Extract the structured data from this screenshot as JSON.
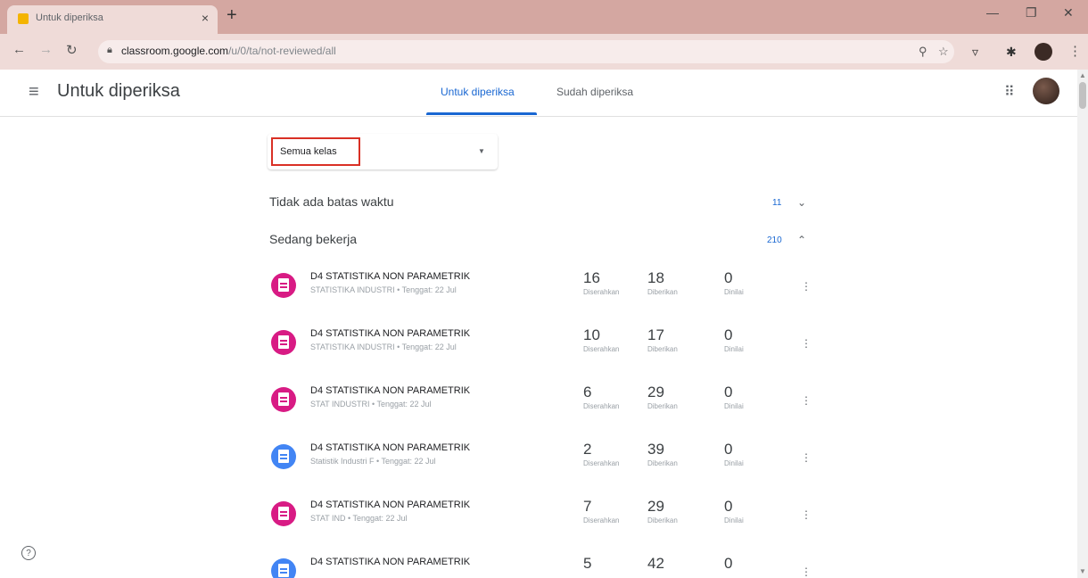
{
  "browser": {
    "tab_title": "Untuk diperiksa",
    "close_glyph": "×",
    "newtab_glyph": "+",
    "url_host": "classroom.google.com",
    "url_path": "/u/0/ta/not-reviewed/all"
  },
  "header": {
    "title": "Untuk diperiksa",
    "tabs": [
      "Untuk diperiksa",
      "Sudah diperiksa"
    ]
  },
  "filter": {
    "label": "Semua kelas"
  },
  "sections": [
    {
      "title": "Tidak ada batas waktu",
      "count": "11",
      "expanded": false
    },
    {
      "title": "Sedang bekerja",
      "count": "210",
      "expanded": true
    }
  ],
  "assignments": [
    {
      "title": "D4 STATISTIKA NON PARAMETRIK",
      "subtitle": "STATISTIKA INDUSTRI • Tenggat: 22 Jul",
      "color": "#d81b84",
      "turned_in": "16",
      "turned_in_label": "Diserahkan",
      "assigned": "18",
      "assigned_label": "Diberikan",
      "graded": "0",
      "graded_label": "Dinilai"
    },
    {
      "title": "D4 STATISTIKA NON PARAMETRIK",
      "subtitle": "STATISTIKA INDUSTRI • Tenggat: 22 Jul",
      "color": "#d81b84",
      "turned_in": "10",
      "turned_in_label": "Diserahkan",
      "assigned": "17",
      "assigned_label": "Diberikan",
      "graded": "0",
      "graded_label": "Dinilai"
    },
    {
      "title": "D4 STATISTIKA NON PARAMETRIK",
      "subtitle": "STAT INDUSTRI • Tenggat: 22 Jul",
      "color": "#d81b84",
      "turned_in": "6",
      "turned_in_label": "Diserahkan",
      "assigned": "29",
      "assigned_label": "Diberikan",
      "graded": "0",
      "graded_label": "Dinilai"
    },
    {
      "title": "D4 STATISTIKA NON PARAMETRIK",
      "subtitle": "Statistik Industri F • Tenggat: 22 Jul",
      "color": "#4285f4",
      "turned_in": "2",
      "turned_in_label": "Diserahkan",
      "assigned": "39",
      "assigned_label": "Diberikan",
      "graded": "0",
      "graded_label": "Dinilai"
    },
    {
      "title": "D4 STATISTIKA NON PARAMETRIK",
      "subtitle": "STAT IND • Tenggat: 22 Jul",
      "color": "#d81b84",
      "turned_in": "7",
      "turned_in_label": "Diserahkan",
      "assigned": "29",
      "assigned_label": "Diberikan",
      "graded": "0",
      "graded_label": "Dinilai"
    },
    {
      "title": "D4 STATISTIKA NON PARAMETRIK",
      "subtitle": "",
      "color": "#4285f4",
      "turned_in": "5",
      "turned_in_label": "",
      "assigned": "42",
      "assigned_label": "",
      "graded": "0",
      "graded_label": ""
    }
  ],
  "icons": [
    "menu-icon",
    "apps-icon",
    "help-icon",
    "more-vert-icon",
    "assignment-icon",
    "chevron-down-icon",
    "chevron-up-icon",
    "search-icon",
    "star-icon",
    "lock-icon"
  ]
}
